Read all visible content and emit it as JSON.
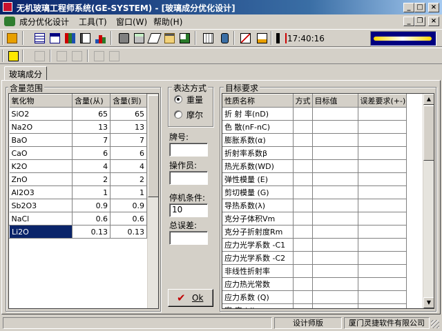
{
  "window": {
    "title": "无机玻璃工程师系统(GE-SYSTEM) - [玻璃成分优化设计]",
    "min_label": "_",
    "max_label": "□",
    "close_label": "×",
    "restore_label": "❐"
  },
  "menu": {
    "items": [
      "成分优化设计",
      "工具(T)",
      "窗口(W)",
      "帮助(H)"
    ]
  },
  "toolbar": {
    "clock": "17:40:16"
  },
  "tab": {
    "label": "玻璃成分"
  },
  "content_range": {
    "title": "含量范围",
    "headers": [
      "氧化物",
      "含量(从)",
      "含量(到)"
    ],
    "rows": [
      [
        "SiO2",
        "65",
        "65"
      ],
      [
        "Na2O",
        "13",
        "13"
      ],
      [
        "BaO",
        "7",
        "7"
      ],
      [
        "CaO",
        "6",
        "6"
      ],
      [
        "K2O",
        "4",
        "4"
      ],
      [
        "ZnO",
        "2",
        "2"
      ],
      [
        "Al2O3",
        "1",
        "1"
      ],
      [
        "Sb2O3",
        "0.9",
        "0.9"
      ],
      [
        "NaCl",
        "0.6",
        "0.6"
      ],
      [
        "Li2O",
        "0.13",
        "0.13"
      ]
    ],
    "selected_row": 9
  },
  "expression": {
    "title": "表达方式",
    "options": [
      "重量",
      "摩尔"
    ],
    "selected": 0
  },
  "fields": {
    "brand_label": "牌号:",
    "brand_value": "",
    "operator_label": "操作员:",
    "operator_value": "",
    "stop_label": "停机条件:",
    "stop_value": "10",
    "error_label": "总误差:",
    "error_value": ""
  },
  "ok_button": {
    "label": "Ok",
    "check": "✔"
  },
  "targets": {
    "title": "目标要求",
    "headers": [
      "性质名称",
      "方式",
      "目标值",
      "误差要求(+-)"
    ],
    "rows": [
      "折 射 率(nD)",
      "色 散(nF-nC)",
      "膨胀系数(α)",
      "折射率系数β",
      "热光系数(WD)",
      "弹性模量 (E)",
      "剪切模量 (G)",
      "导热系数(λ)",
      "克分子体积Vm",
      "克分子折射度Rm",
      "应力光学系数 -C1",
      "应力光学系数 -C2",
      "非线性折射率",
      "应力热光常数",
      "应力系数 (Q)",
      "密  度  (d)"
    ]
  },
  "status": {
    "cells": [
      "",
      "设计师版",
      "厦门灵捷软件有限公司"
    ]
  },
  "colors": {
    "titlebar_start": "#0a246a",
    "titlebar_end": "#a6caf0",
    "face": "#d4d0c8",
    "selection": "#0a246a",
    "checkmark": "#c00000"
  }
}
